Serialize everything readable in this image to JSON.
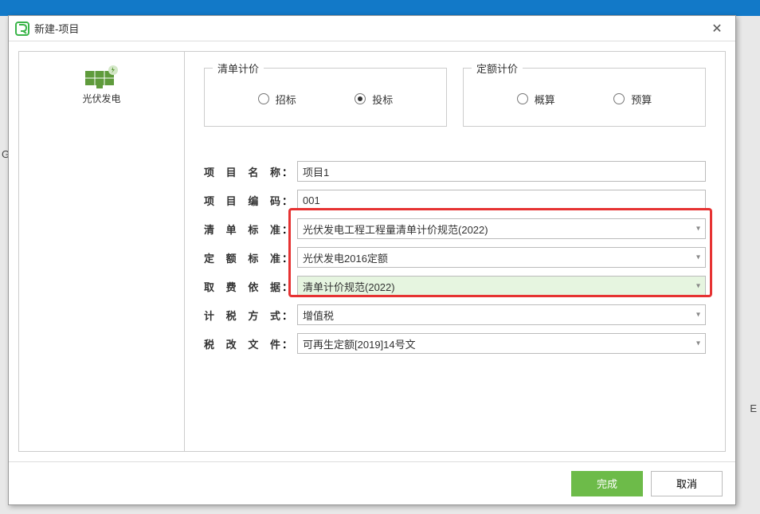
{
  "bg_header_partial": "",
  "dialog": {
    "title": "新建-项目"
  },
  "sidebar": {
    "item": {
      "label": "光伏发电"
    }
  },
  "pricing_type": {
    "list_based": {
      "legend": "清单计价",
      "options": [
        "招标",
        "投标"
      ],
      "selected_index": 1
    },
    "quota_based": {
      "legend": "定额计价",
      "options": [
        "概算",
        "预算"
      ],
      "selected_index": -1
    }
  },
  "form": {
    "project_name": {
      "label": "项目名称",
      "value": "项目1"
    },
    "project_code": {
      "label": "项目编码",
      "value": "001"
    },
    "list_standard": {
      "label": "清单标准",
      "value": "光伏发电工程工程量清单计价规范(2022)"
    },
    "quota_standard": {
      "label": "定额标准",
      "value": "光伏发电2016定额"
    },
    "fee_basis": {
      "label": "取费依据",
      "value": "清单计价规范(2022)"
    },
    "tax_method": {
      "label": "计税方式",
      "value": "增值税"
    },
    "tax_document": {
      "label": "税改文件",
      "value": "可再生定额[2019]14号文"
    }
  },
  "footer": {
    "confirm": "完成",
    "cancel": "取消"
  },
  "bg_labels": {
    "g": "G",
    "e": "E"
  }
}
